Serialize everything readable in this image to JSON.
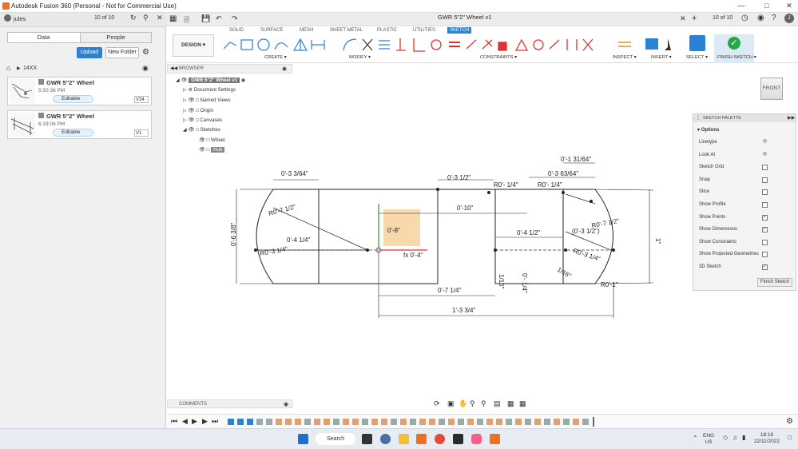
{
  "window": {
    "title": "Autodesk Fusion 360 (Personal - Not for Commercial Use)"
  },
  "left_panel": {
    "user": "jules",
    "counter": "10 of 10",
    "tabs": [
      "Data",
      "People"
    ],
    "upload_label": "Upload",
    "new_folder_label": "New Folder",
    "breadcrumb": "14XX",
    "files": [
      {
        "name": "GWR 5\"2\" Wheel",
        "time": "5:50:36 PM",
        "status": "Editable",
        "version": "V34"
      },
      {
        "name": "GWR 5\"2\" Wheel",
        "time": "6:19:06 PM",
        "status": "Editable",
        "version": "V1"
      }
    ]
  },
  "header": {
    "doc_title": "GWR 5\"2\" Wheel v1",
    "counter": "10 of 10"
  },
  "toolbar": {
    "tabs": [
      "SOLID",
      "SURFACE",
      "MESH",
      "SHEET METAL",
      "PLASTIC",
      "UTILITIES",
      "SKETCH"
    ],
    "active_tab": "SKETCH",
    "design_label": "DESIGN",
    "groups": [
      "CREATE",
      "MODIFY",
      "CONSTRAINTS",
      "INSPECT",
      "INSERT",
      "SELECT",
      "FINISH SKETCH"
    ],
    "accent": "#2a82d7",
    "finish_color": "#27a745"
  },
  "browser": {
    "title": "BROWSER",
    "root": "GWR 5\"2\" Wheel v1",
    "items": [
      "Document Settings",
      "Named Views",
      "Origin",
      "Canvases",
      "Sketches",
      "Wheel",
      "Hub"
    ]
  },
  "viewcube": {
    "label": "FRONT"
  },
  "sketch_palette": {
    "title": "SKETCH PALETTE",
    "section": "Options",
    "rows": [
      {
        "label": "Linetype",
        "checked": null
      },
      {
        "label": "Look At",
        "checked": null
      },
      {
        "label": "Sketch Grid",
        "checked": false
      },
      {
        "label": "Snap",
        "checked": false
      },
      {
        "label": "Slice",
        "checked": false
      },
      {
        "label": "Show Profile",
        "checked": false
      },
      {
        "label": "Show Points",
        "checked": true
      },
      {
        "label": "Show Dimensions",
        "checked": true
      },
      {
        "label": "Show Constraints",
        "checked": false
      },
      {
        "label": "Show Projected Geometries",
        "checked": false
      },
      {
        "label": "3D Sketch",
        "checked": true
      }
    ],
    "finish_label": "Finish Sketch"
  },
  "comments": {
    "label": "COMMENTS"
  },
  "sketch_dims": {
    "d1": "0'-3 3/64\"",
    "d2": "0'-3 1/2\"",
    "d3": "0'-1 31/64\"",
    "d4": "0'-3 63/64\"",
    "d5": "R0'- 1/4\"",
    "d6": "R0'- 1/4\"",
    "d7": "0'-10\"",
    "d8": "R0'-7 1/2\"",
    "d9": "0'-8\"",
    "d10": "0'-4 1/4\"",
    "d11": "R0'-3 1/4\"",
    "d12": "fx  0'-4\"",
    "d13": "0'-4 1/2\"",
    "d14": "(0'-3 1/2\")",
    "d15": "R0'-7 1/2\"",
    "d16": "R0'-3 1/4\"",
    "d17": "0'-6 3/8\"",
    "d18": "1\"",
    "d19": "0'-7 1/4\"",
    "d20": "1'-3 3/4\"",
    "d21": "R0'-1\"",
    "d22": "0'- 1/4\"",
    "d23": "1/16\"",
    "d24": "1/16\""
  },
  "taskbar": {
    "search_label": "Search",
    "lang": "ENG",
    "region": "US",
    "time": "18:19",
    "date": "22/11/2022"
  }
}
